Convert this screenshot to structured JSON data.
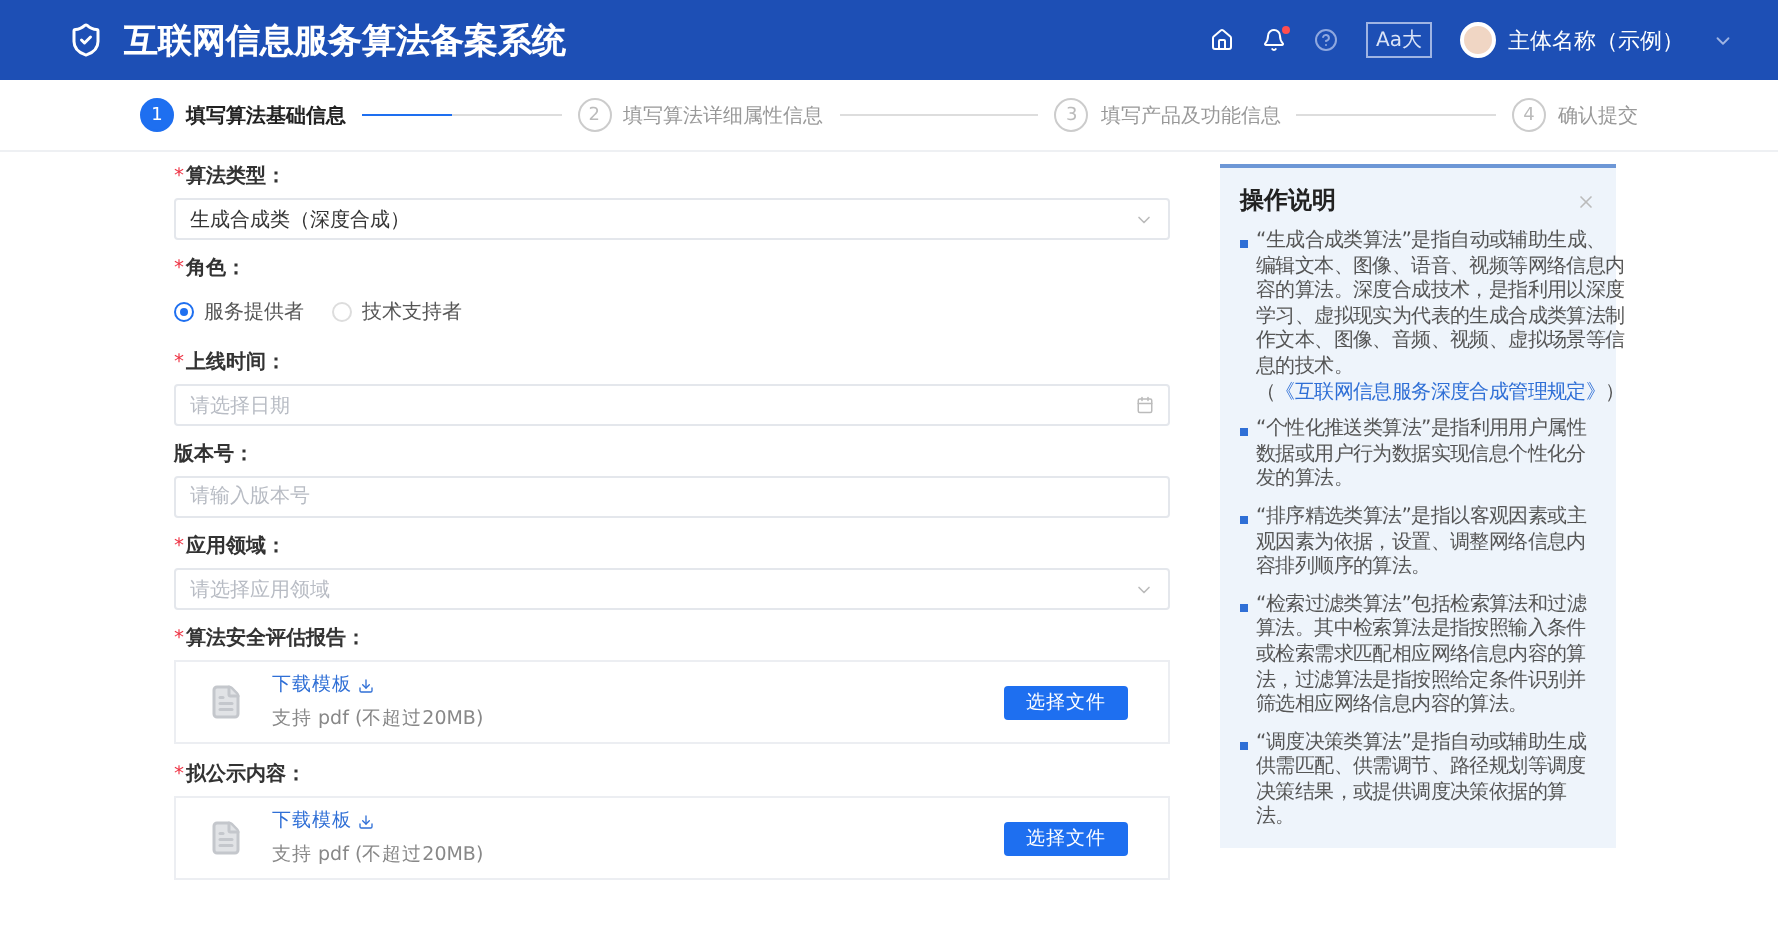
{
  "header": {
    "title": "互联网信息服务算法备案系统",
    "font_toggle": "Aa大",
    "notifications_unread": true,
    "user": "主体名称（示例）"
  },
  "steps": [
    {
      "number": "1",
      "label": "填写算法基础信息",
      "selected": true
    },
    {
      "number": "2",
      "label": "填写算法详细属性信息",
      "selected": false
    },
    {
      "number": "3",
      "label": "填写产品及功能信息",
      "selected": false
    },
    {
      "number": "4",
      "label": "确认提交",
      "selected": false
    }
  ],
  "form": [
    {
      "kind": "select",
      "mark": "*",
      "label": "算法类型：",
      "value": "生成合成类（深度合成）"
    },
    {
      "kind": "radio",
      "mark": "*",
      "label": "角色：",
      "options": [
        {
          "label": "服务提供者",
          "selected": true
        },
        {
          "label": "技术支持者",
          "selected": false
        }
      ]
    },
    {
      "kind": "date",
      "mark": "*",
      "label": "上线时间：",
      "placeholder": "请选择日期"
    },
    {
      "kind": "input",
      "label": "版本号：",
      "placeholder": "请输入版本号"
    },
    {
      "kind": "select",
      "mark": "*",
      "label": "应用领域：",
      "placeholder": "请选择应用领域"
    },
    {
      "kind": "upload",
      "mark": "*",
      "label": "算法安全评估报告：",
      "link": "下载模板",
      "hint": "支持 pdf (不超过20MB)",
      "button": "选择文件"
    },
    {
      "kind": "upload",
      "mark": "*",
      "label": "拟公示内容：",
      "link": "下载模板",
      "hint": "支持 pdf (不超过20MB)",
      "button": "选择文件"
    }
  ],
  "help_panel": {
    "title": "操作说明",
    "items": [
      {
        "text": "“生成合成类算法”是指自动或辅助生成、编辑文本、图像、语音、视频等网络信息内容的算法。深度合成技术，是指利用以深度学习、虚拟现实为代表的生成合成类算法制作文本、图像、音频、视频、虚拟场景等信息的技术。（",
        "link": "《互联网信息服务深度合成管理规定》",
        "after": "）"
      },
      {
        "text": "“个性化推送类算法”是指利用用户属性数据或用户行为数据实现信息个性化分发的算法。"
      },
      {
        "text": "“排序精选类算法”是指以客观因素或主观因素为依据，设置、调整网络信息内容排列顺序的算法。"
      },
      {
        "text": "“检索过滤类算法”包括检索算法和过滤算法。其中检索算法是指按照输入条件或检索需求匹配相应网络信息内容的算法，过滤算法是指按照给定条件识别并筛选相应网络信息内容的算法。"
      },
      {
        "text": "“调度决策类算法”是指自动或辅助生成供需匹配、供需调节、路径规划等调度决策结果，或提供调度决策依据的算法。"
      }
    ]
  }
}
